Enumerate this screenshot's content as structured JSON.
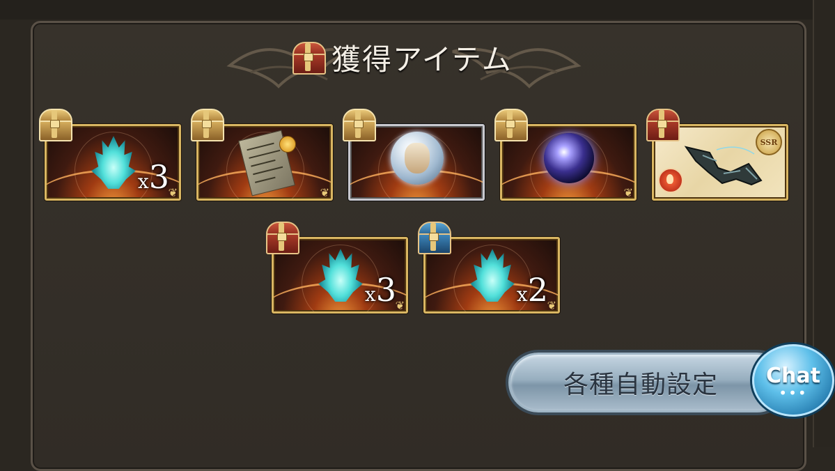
{
  "header": {
    "title": "獲得アイテム",
    "title_icon": "treasure-chest-red-icon"
  },
  "items_row1": [
    {
      "name": "element-flame-item",
      "chest": "gold",
      "qty_x": "x",
      "qty_n": "3"
    },
    {
      "name": "scroll-item",
      "chest": "gold",
      "qty_x": "",
      "qty_n": ""
    },
    {
      "name": "character-orb-item",
      "chest": "gold",
      "qty_x": "",
      "qty_n": ""
    },
    {
      "name": "cosmic-orb-item",
      "chest": "gold",
      "qty_x": "",
      "qty_n": ""
    },
    {
      "name": "ssr-weapon-item",
      "chest": "red",
      "rarity": "SSR",
      "element": "fire"
    }
  ],
  "items_row2": [
    {
      "name": "element-flame-item",
      "chest": "red",
      "qty_x": "x",
      "qty_n": "3"
    },
    {
      "name": "element-flame-item",
      "chest": "blue",
      "qty_x": "x",
      "qty_n": "2"
    }
  ],
  "buttons": {
    "auto_settings": "各種自動設定",
    "chat": "Chat",
    "chat_dots": "•••"
  },
  "colors": {
    "chest_gold": "#d4ac5c",
    "chest_red": "#a83a28",
    "chest_blue": "#3d85b9",
    "frame_gold": "#d9b662"
  }
}
